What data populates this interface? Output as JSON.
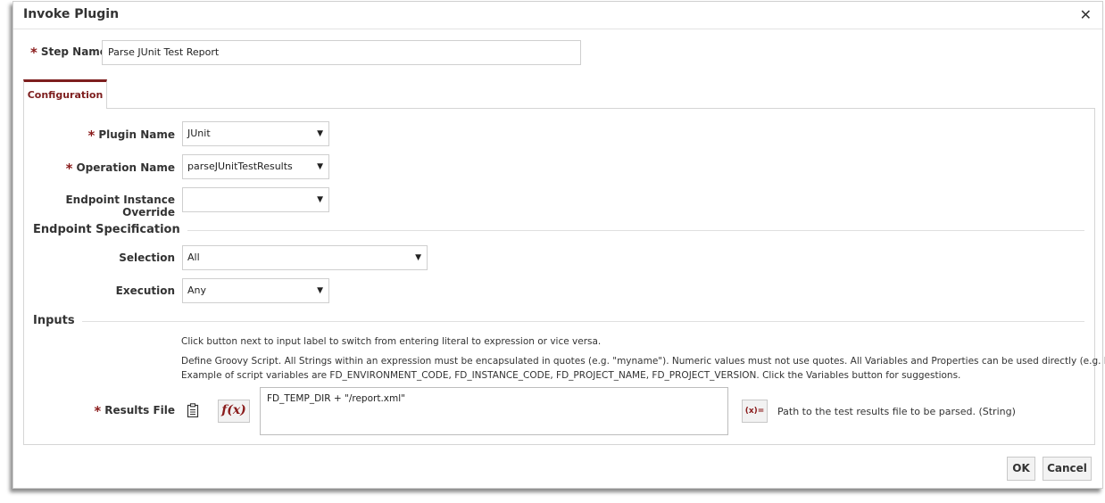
{
  "dialog": {
    "title": "Invoke Plugin",
    "close_icon": "close-icon"
  },
  "step_name": {
    "required_mark": "*",
    "label": "Step Name",
    "value": "Parse JUnit Test Report"
  },
  "tabs": [
    {
      "label": "Configuration",
      "active": true
    }
  ],
  "fields": {
    "plugin_name": {
      "required_mark": "*",
      "label": "Plugin Name",
      "value": "JUnit"
    },
    "operation_name": {
      "required_mark": "*",
      "label": "Operation Name",
      "value": "parseJUnitTestResults"
    },
    "endpoint_override": {
      "label": "Endpoint Instance Override",
      "value": ""
    }
  },
  "endpoint_spec": {
    "heading": "Endpoint Specification",
    "selection": {
      "label": "Selection",
      "value": "All"
    },
    "execution": {
      "label": "Execution",
      "value": "Any"
    }
  },
  "inputs": {
    "heading": "Inputs",
    "help_line1": "Click button next to input label to switch from entering literal to expression or vice versa.",
    "help_line2": "Define Groovy Script. All Strings within an expression must be encapsulated in quotes (e.g. \"myname\"). Numeric values must not use quotes. All Variables and Properties can be used directly (e.g. MY_VAR).",
    "help_line3": "Example of script variables are FD_ENVIRONMENT_CODE, FD_INSTANCE_CODE, FD_PROJECT_NAME, FD_PROJECT_VERSION. Click the Variables button for suggestions.",
    "results_file": {
      "required_mark": "*",
      "label": "Results File",
      "fx_label": "f(x)",
      "expression": "FD_TEMP_DIR + \"/report.xml\"",
      "variables_button": "(x)=",
      "hint": "Path to the test results file to be parsed. (String)"
    }
  },
  "buttons": {
    "ok": "OK",
    "cancel": "Cancel"
  },
  "colors": {
    "accent": "#7d1e1e",
    "required": "#8a1b1b",
    "border": "#cfcfcf"
  }
}
